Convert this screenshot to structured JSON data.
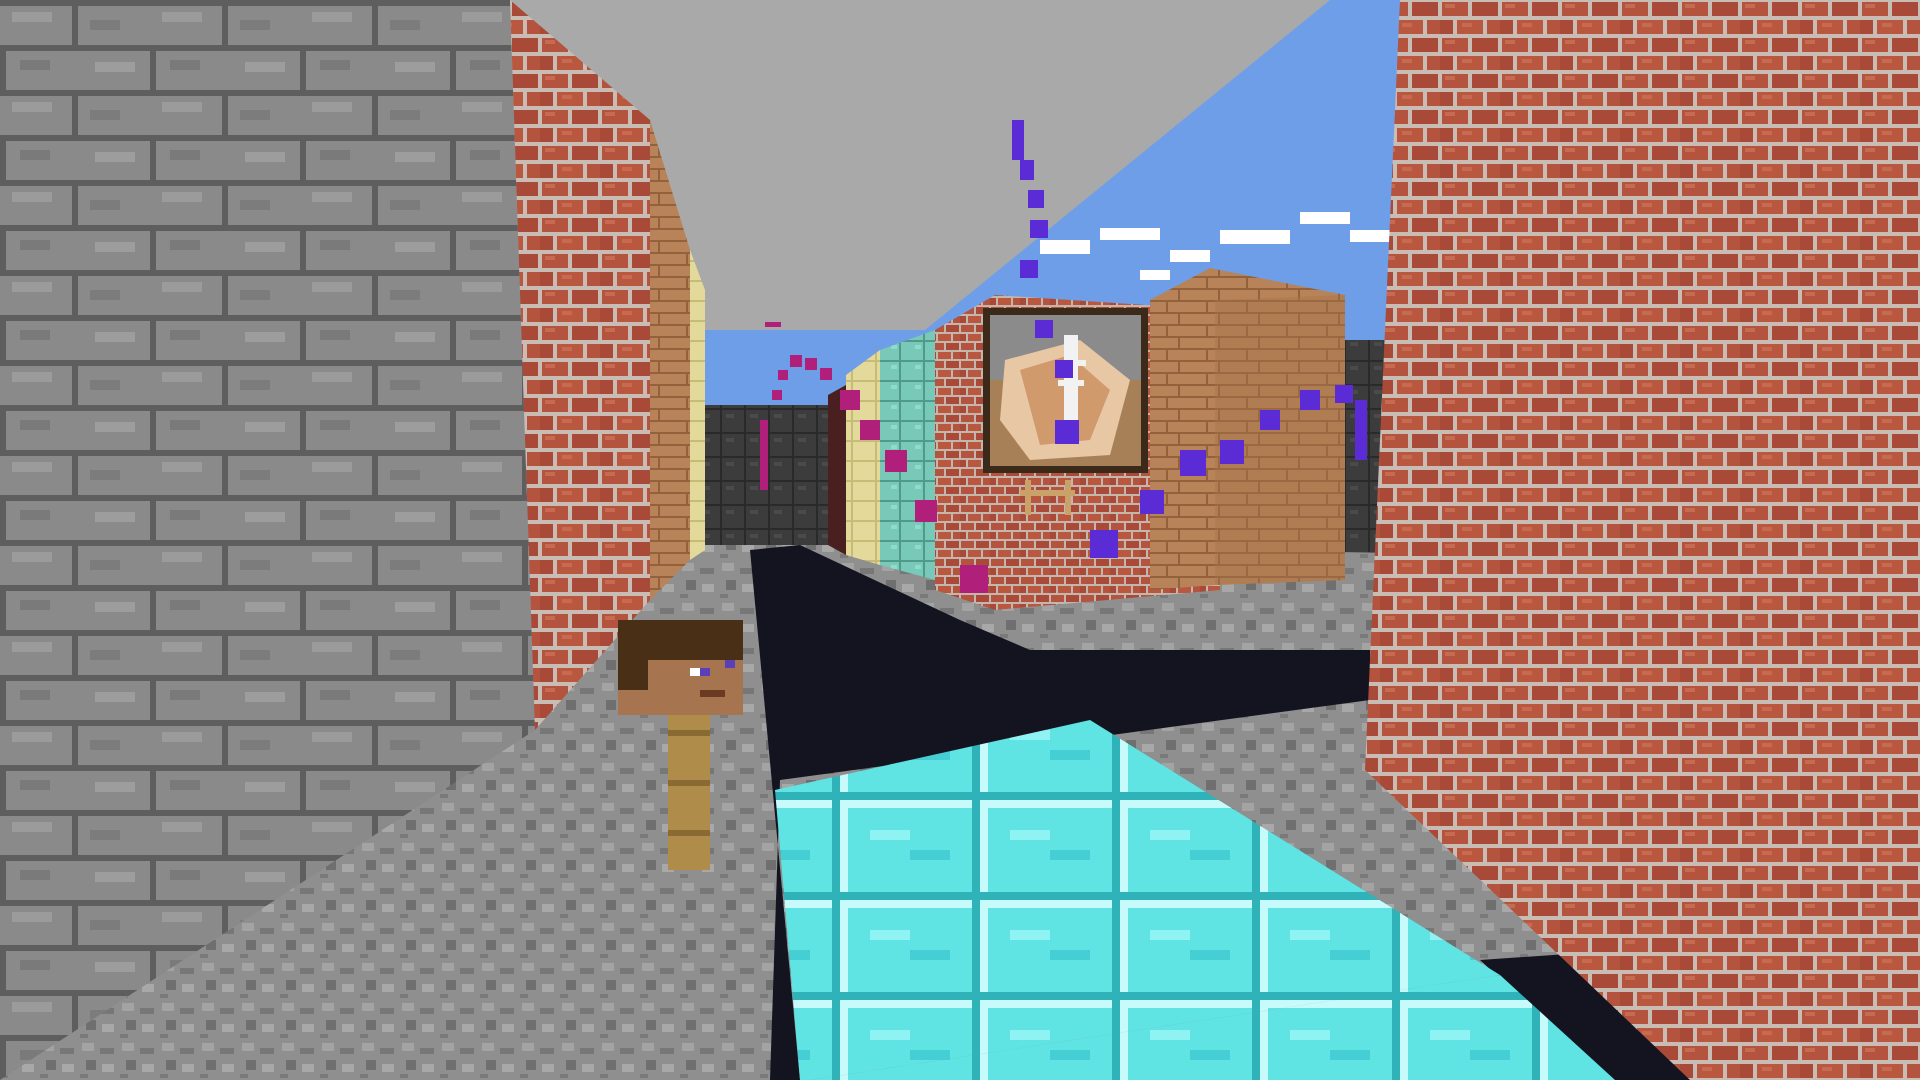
{
  "scene": {
    "kind": "first-person voxel street view",
    "blocks": {
      "stone_bricks": "stone-bricks-wall",
      "red_bricks": "red-bricks-wall",
      "cobblestone": "cobblestone-floor",
      "diamond_block": "diamond-block-path",
      "black_wool": "black-road",
      "prismarine": "prismarine-wall",
      "sandstone": "sandstone-wall",
      "clay_bricks": "clay-brick-tower"
    },
    "entities": {
      "player_head": "steve-head-on-post",
      "painting": "skeleton-painting",
      "armor_stand": "armor-stand-legs"
    },
    "particles": {
      "purple_trail": "purple-particle-trail",
      "magenta_trail": "magenta-particle-trail"
    }
  },
  "colors": {
    "sky": "#6f9ee8",
    "ceiling": "#a9a9a9",
    "stone": "#8a8a8a",
    "stone_mortar": "#5a5a5a",
    "brick": "#b4533e",
    "brick_mortar": "#c8bcb4",
    "cobble": "#8f8f8f",
    "diamond": "#5fe3e3",
    "diamond_edge": "#c7fbfb",
    "road": "#141420",
    "purple": "#5b2bd6",
    "magenta": "#b0207a"
  }
}
